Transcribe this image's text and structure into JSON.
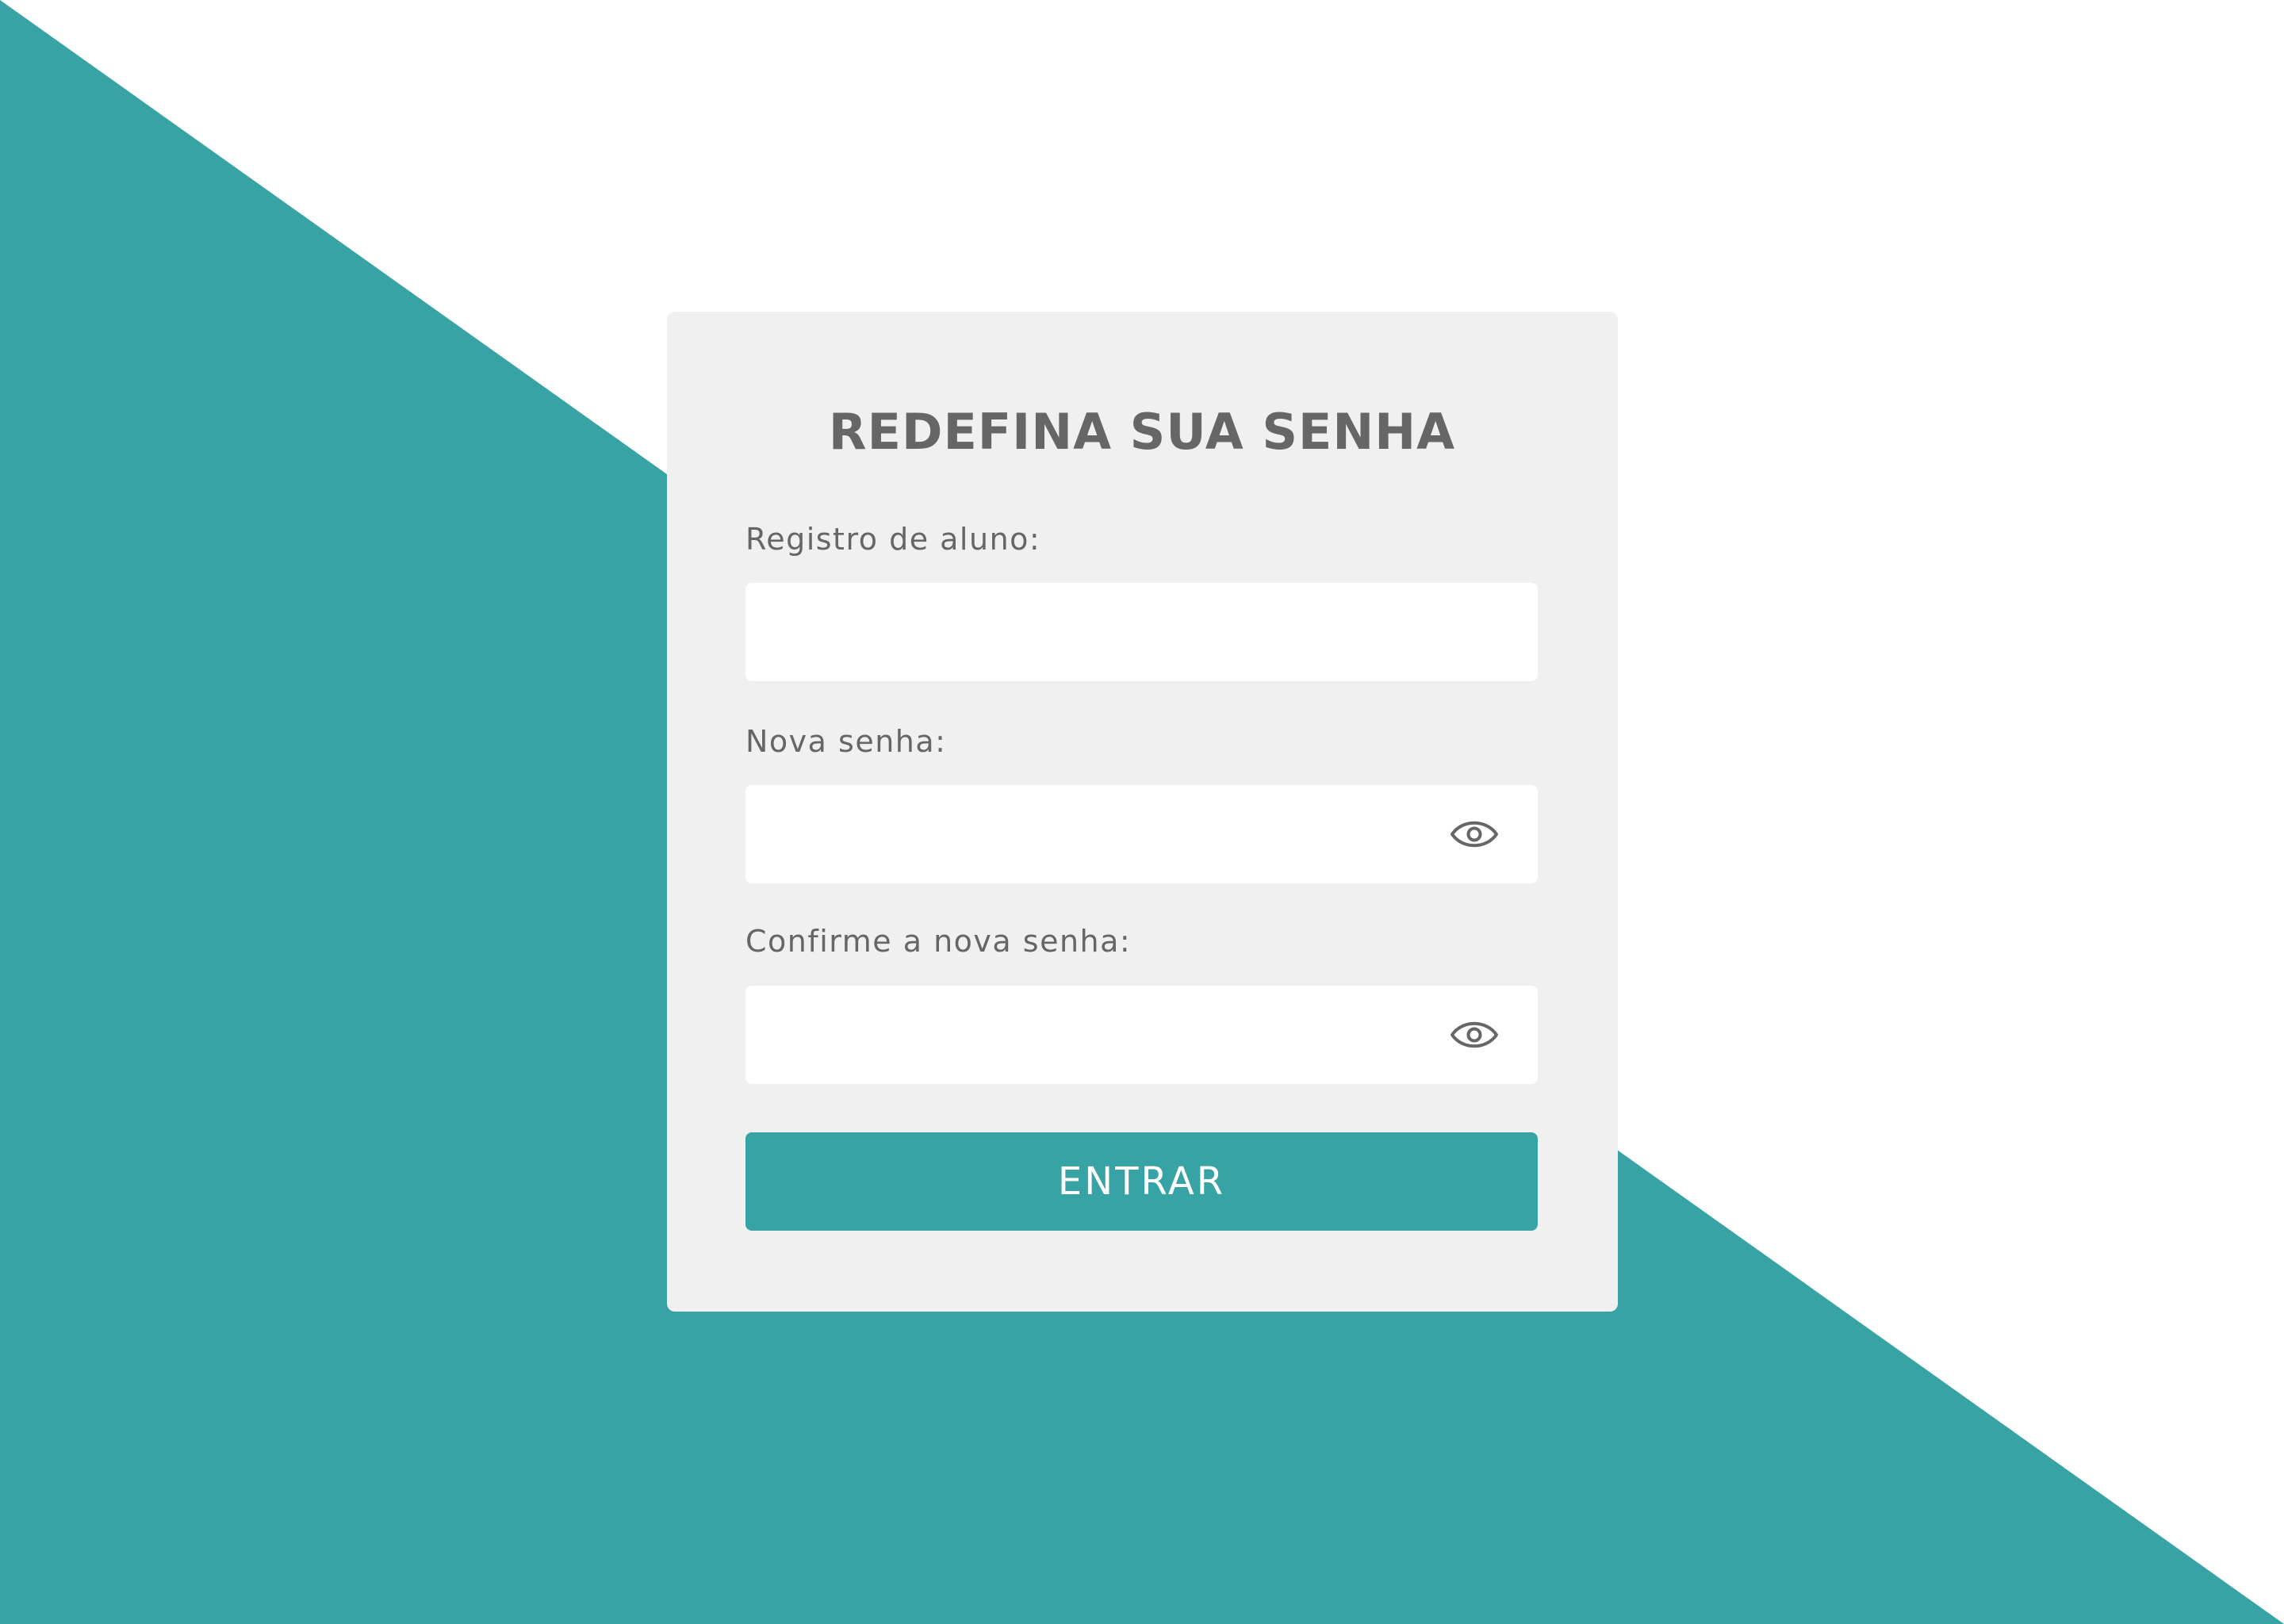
{
  "theme": {
    "accent_color": "#38a3a5",
    "card_color": "#f0f0f0",
    "text_color": "#666666",
    "background_color": "#ffffff"
  },
  "form": {
    "title": "REDEFINA SUA SENHA",
    "fields": [
      {
        "label": "Registro de aluno:",
        "value": "",
        "placeholder": "",
        "type": "text",
        "has_visibility_toggle": false
      },
      {
        "label": "Nova senha:",
        "value": "",
        "placeholder": "",
        "type": "password",
        "has_visibility_toggle": true,
        "toggle_icon": "eye-icon"
      },
      {
        "label": "Confirme a nova senha:",
        "value": "",
        "placeholder": "",
        "type": "password",
        "has_visibility_toggle": true,
        "toggle_icon": "eye-icon"
      }
    ],
    "submit_label": "ENTRAR"
  }
}
